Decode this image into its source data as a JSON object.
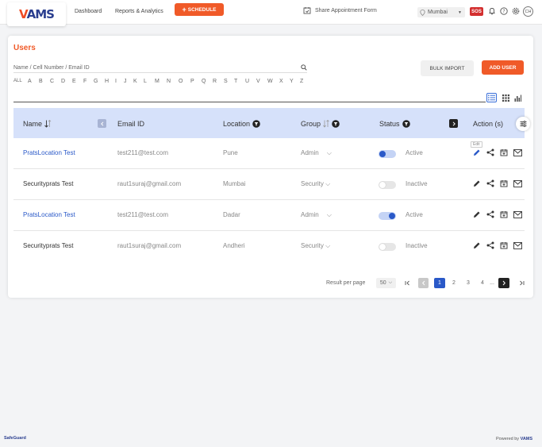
{
  "header": {
    "logo_prefix": "V",
    "logo_rest": "AMS",
    "nav": [
      "Dashboard",
      "Reports & Analytics"
    ],
    "schedule_label": "SCHEDULE",
    "share_label": "Share Appointment Form",
    "location": "Mumbai",
    "sos_label": "SOS",
    "avatar_initials": "CH"
  },
  "page": {
    "title": "Users",
    "search_placeholder": "Name / Cell Number / Email ID",
    "alphabet": [
      "ALL",
      "A",
      "B",
      "C",
      "D",
      "E",
      "F",
      "G",
      "H",
      "I",
      "J",
      "K",
      "L",
      "M",
      "N",
      "O",
      "P",
      "Q",
      "R",
      "S",
      "T",
      "U",
      "V",
      "W",
      "X",
      "Y",
      "Z"
    ],
    "bulk_import_label": "BULK IMPORT",
    "add_user_label": "ADD USER"
  },
  "table": {
    "columns": [
      "Name",
      "Email ID",
      "Location",
      "Group",
      "Status",
      "Action (s)"
    ],
    "tooltip": "Edit",
    "rows": [
      {
        "name": "PratsLocation Test",
        "email": "test211@test.com",
        "location": "Pune",
        "group": "Admin",
        "status": "Active",
        "active": true,
        "link": true
      },
      {
        "name": "Securityprats Test",
        "email": "raut1suraj@gmail.com",
        "location": "Mumbai",
        "group": "Security",
        "status": "Inactive",
        "active": false,
        "link": false
      },
      {
        "name": "PratsLocation Test",
        "email": "test211@test.com",
        "location": "Dadar",
        "group": "Admin",
        "status": "Active",
        "active": true,
        "link": true
      },
      {
        "name": "Securityprats Test",
        "email": "raut1suraj@gmail.com",
        "location": "Andheri",
        "group": "Security",
        "status": "Inactive",
        "active": false,
        "link": false
      }
    ]
  },
  "pagination": {
    "label": "Result per page",
    "per_page": "50",
    "pages": [
      "1",
      "2",
      "3",
      "4",
      "..."
    ],
    "current": "1"
  },
  "footer": {
    "left": "SafeGuard",
    "right_prefix": "Powered by",
    "right_brand": "VAMS"
  },
  "colors": {
    "accent": "#f05a28",
    "primary": "#2a59c8",
    "header_bg": "#d6e1fa"
  }
}
